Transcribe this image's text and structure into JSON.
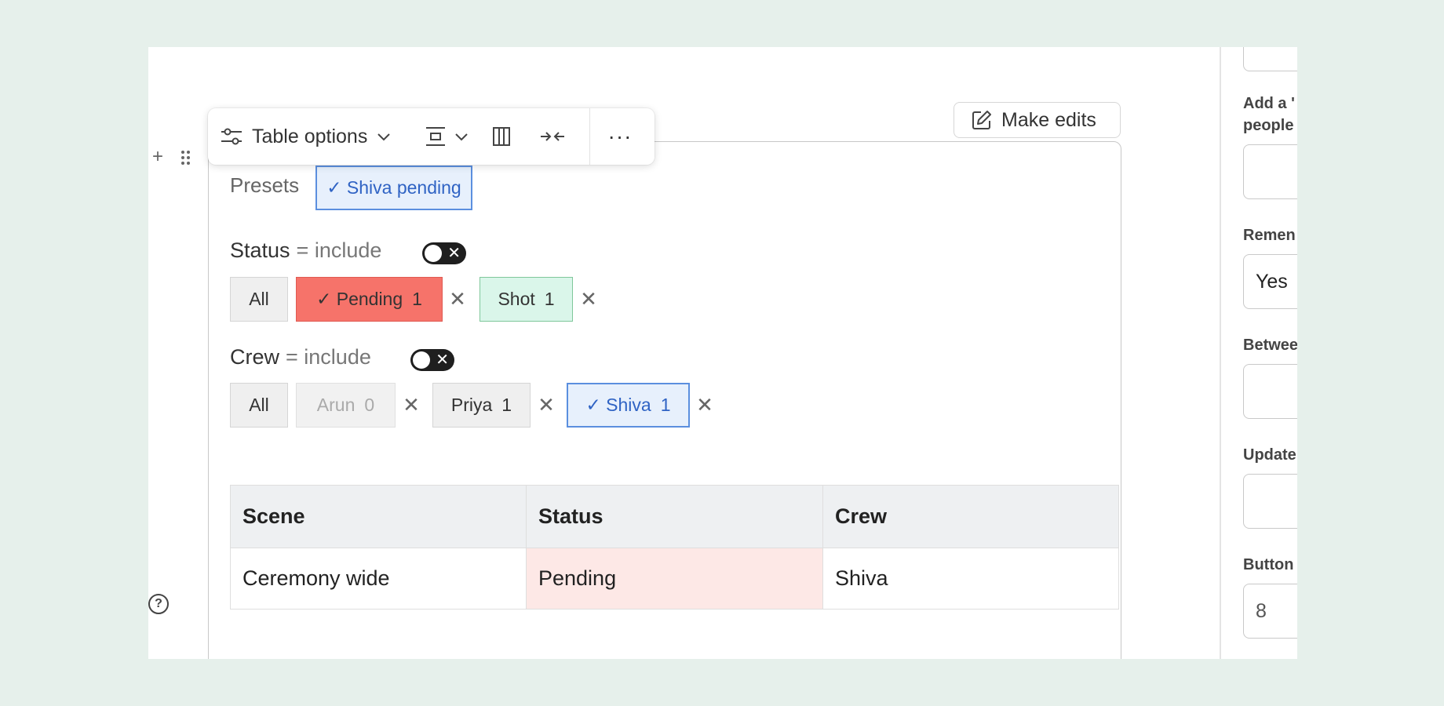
{
  "toolbar": {
    "table_options_label": "Table options",
    "more_label": "···"
  },
  "make_edits_label": "Make edits",
  "presets": {
    "label": "Presets",
    "active": "✓ Shiva pending"
  },
  "filters": {
    "status": {
      "label": "Status",
      "mode": "= include",
      "chips": [
        {
          "label": "All"
        },
        {
          "label": "✓ Pending",
          "count": "1",
          "color": "#f6736a"
        },
        {
          "label": "Shot",
          "count": "1",
          "color": "#daf6ea"
        }
      ]
    },
    "crew": {
      "label": "Crew",
      "mode": "= include",
      "chips": [
        {
          "label": "All"
        },
        {
          "label": "Arun",
          "count": "0"
        },
        {
          "label": "Priya",
          "count": "1"
        },
        {
          "label": "✓ Shiva",
          "count": "1"
        }
      ]
    },
    "remove_glyph": "✕"
  },
  "table": {
    "headers": [
      "Scene",
      "Status",
      "Crew"
    ],
    "rows": [
      [
        "Ceremony wide",
        "Pending",
        "Shiva"
      ]
    ]
  },
  "right_panel": {
    "labels": [
      {
        "line1": "Add a '",
        "line2": "people"
      },
      {
        "line1": "Remen"
      },
      {
        "line1": "Betwee"
      },
      {
        "line1": "Update"
      },
      {
        "line1": "Button"
      }
    ],
    "remind_value": "Yes",
    "button_value": "8"
  },
  "colors": {
    "selected_accent": "#5b8fdf",
    "pending": "#f6736a",
    "shot": "#daf6ea"
  }
}
